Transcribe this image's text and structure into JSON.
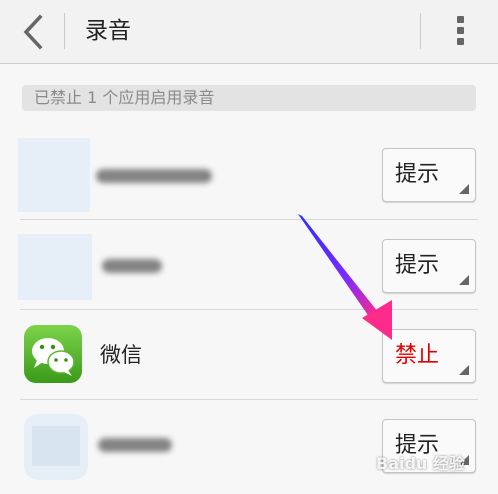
{
  "header": {
    "title": "录音",
    "back_icon": "chevron-left-icon",
    "menu_icon": "more-vertical-icon"
  },
  "notice": {
    "text": "已禁止 1 个应用启用录音"
  },
  "apps": [
    {
      "name": "",
      "permission": "提示"
    },
    {
      "name": "",
      "permission": "提示"
    },
    {
      "name": "微信",
      "permission": "禁止"
    },
    {
      "name": "",
      "permission": "提示"
    }
  ],
  "watermark": "Baidu 经验",
  "colors": {
    "deny": "#e00000",
    "arrow_start": "#2b2bff",
    "arrow_end": "#ff2b8a"
  }
}
